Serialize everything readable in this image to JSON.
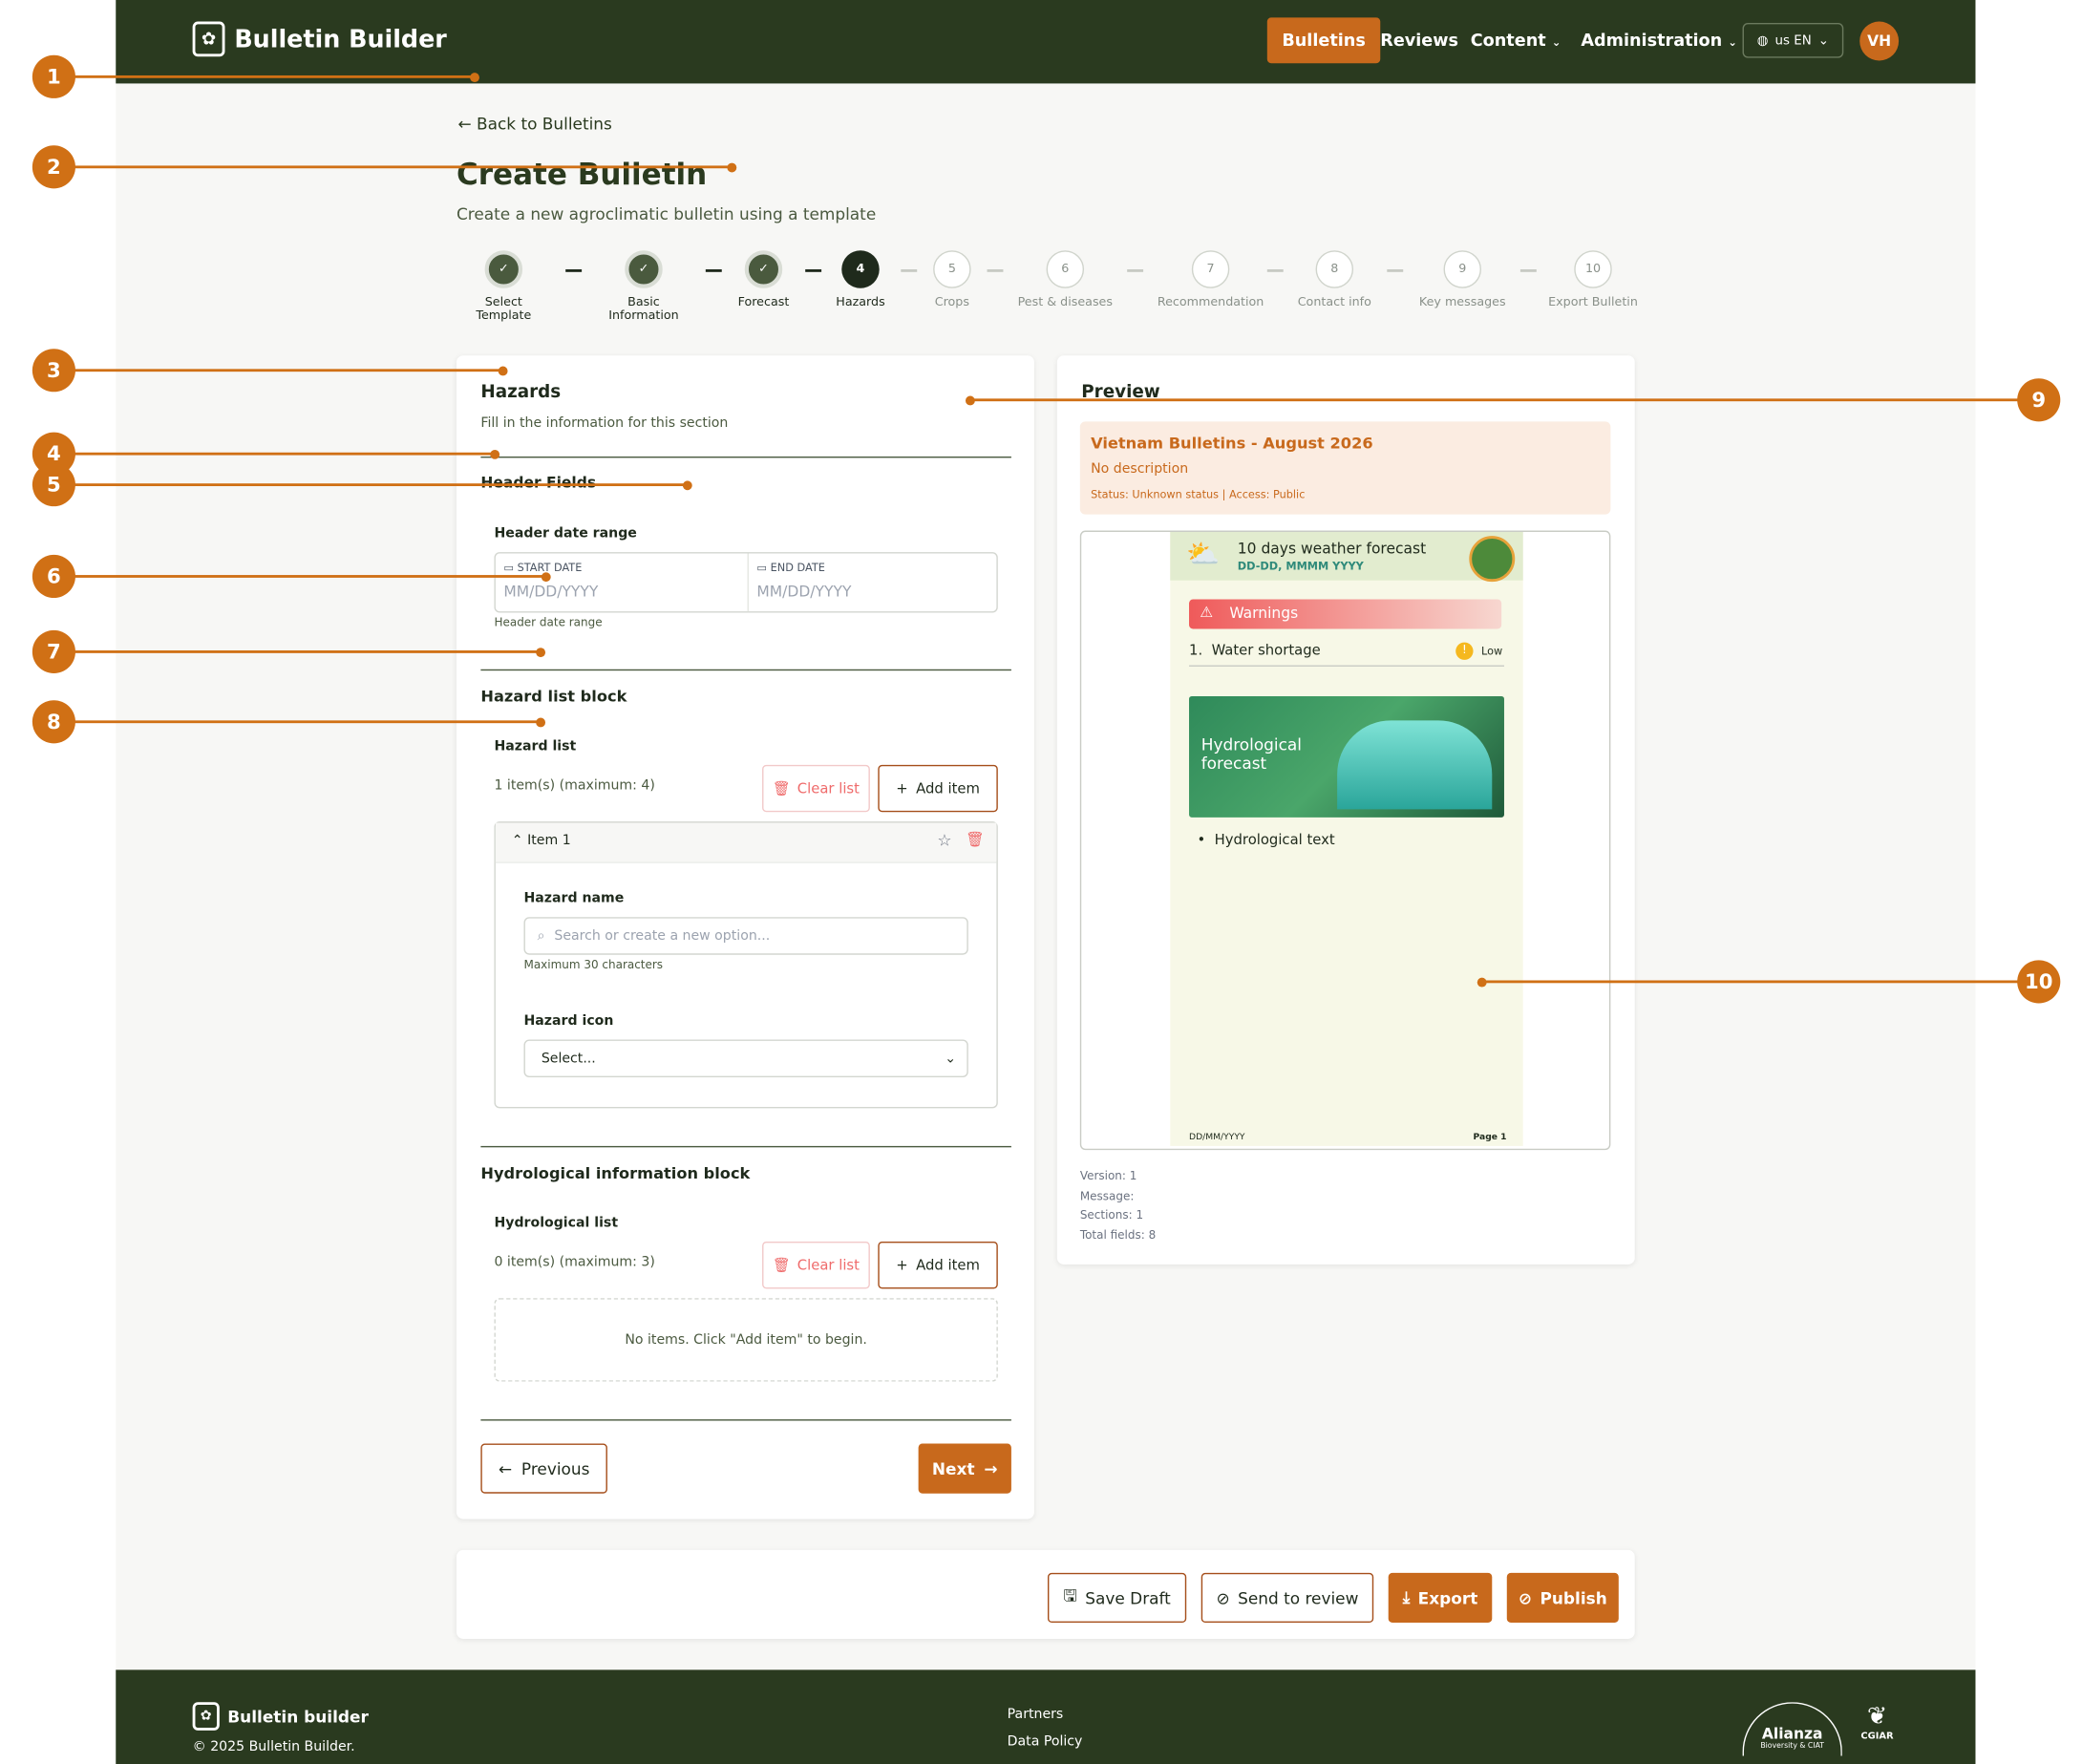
{
  "app": {
    "name": "Bulletin Builder",
    "avatar": "VH",
    "lang": "us EN"
  },
  "nav": {
    "bulletins": "Bulletins",
    "reviews": "Reviews",
    "content": "Content",
    "administration": "Administration"
  },
  "header": {
    "back": "Back to Bulletins",
    "title": "Create Bulletin",
    "subtitle": "Create a new agroclimatic bulletin using a template"
  },
  "steps": [
    {
      "num": "",
      "label1": "Select",
      "label2": "Template",
      "state": "done"
    },
    {
      "num": "",
      "label1": "Basic",
      "label2": "Information",
      "state": "done"
    },
    {
      "num": "",
      "label1": "Forecast",
      "label2": "",
      "state": "done"
    },
    {
      "num": "4",
      "label1": "Hazards",
      "label2": "",
      "state": "current"
    },
    {
      "num": "5",
      "label1": "Crops",
      "label2": "",
      "state": "todo"
    },
    {
      "num": "6",
      "label1": "Pest & diseases",
      "label2": "",
      "state": "todo"
    },
    {
      "num": "7",
      "label1": "Recommendation",
      "label2": "",
      "state": "todo"
    },
    {
      "num": "8",
      "label1": "Contact info",
      "label2": "",
      "state": "todo"
    },
    {
      "num": "9",
      "label1": "Key messages",
      "label2": "",
      "state": "todo"
    },
    {
      "num": "10",
      "label1": "Export Bulletin",
      "label2": "",
      "state": "todo"
    }
  ],
  "form": {
    "section_title": "Hazards",
    "section_desc": "Fill in the information for this section",
    "header_fields": "Header Fields",
    "date_range_label": "Header date range",
    "start_date": "START DATE",
    "end_date": "END DATE",
    "date_placeholder": "MM/DD/YYYY",
    "date_help": "Header date range",
    "hazard_block": "Hazard list block",
    "hazard_list": "Hazard list",
    "hazard_count": "1 item(s) (maximum: 4)",
    "clear_list": "Clear list",
    "add_item": "Add item",
    "item1": "Item 1",
    "hazard_name": "Hazard name",
    "hazard_name_placeholder": "Search or create a new option...",
    "hazard_name_help": "Maximum 30 characters",
    "hazard_icon": "Hazard icon",
    "hazard_icon_value": "Select...",
    "hydro_block": "Hydrological information block",
    "hydro_list": "Hydrological list",
    "hydro_count": "0 item(s) (maximum: 3)",
    "empty": "No items. Click \"Add item\" to begin.",
    "previous": "Previous",
    "next": "Next"
  },
  "preview": {
    "title": "Preview",
    "bulletin_name": "Vietnam Bulletins - August 2026",
    "desc": "No description",
    "status": "Status: Unknown status | Access: Public",
    "doc_title": "10 days weather forecast",
    "doc_date": "DD-DD, MMMM YYYY",
    "warnings": "Warnings",
    "warn_num": "1.",
    "warn_item": "Water shortage",
    "warn_level": "Low",
    "hydro_title1": "Hydrological",
    "hydro_title2": "forecast",
    "hydro_text": "Hydrological text",
    "doc_footer_date": "DD/MM/YYYY",
    "doc_page": "Page 1",
    "meta": [
      "Version: 1",
      "Message:",
      "Sections: 1",
      "Total fields: 8"
    ]
  },
  "actions": {
    "save_draft": "Save Draft",
    "send_review": "Send to review",
    "export": "Export",
    "publish": "Publish"
  },
  "footer": {
    "name": "Bulletin builder",
    "copyright": "© 2025 Bulletin Builder.",
    "partners": "Partners",
    "policy": "Data Policy",
    "logo1": "Alianza",
    "logo1b": "Bioversity & CIAT",
    "logo2": "CGIAR"
  },
  "callouts": [
    "1",
    "2",
    "3",
    "4",
    "5",
    "6",
    "7",
    "8",
    "9",
    "10"
  ],
  "colors": {
    "brand_dark": "#2a3a1f",
    "accent": "#c8691c",
    "danger": "#ef6b6b"
  }
}
